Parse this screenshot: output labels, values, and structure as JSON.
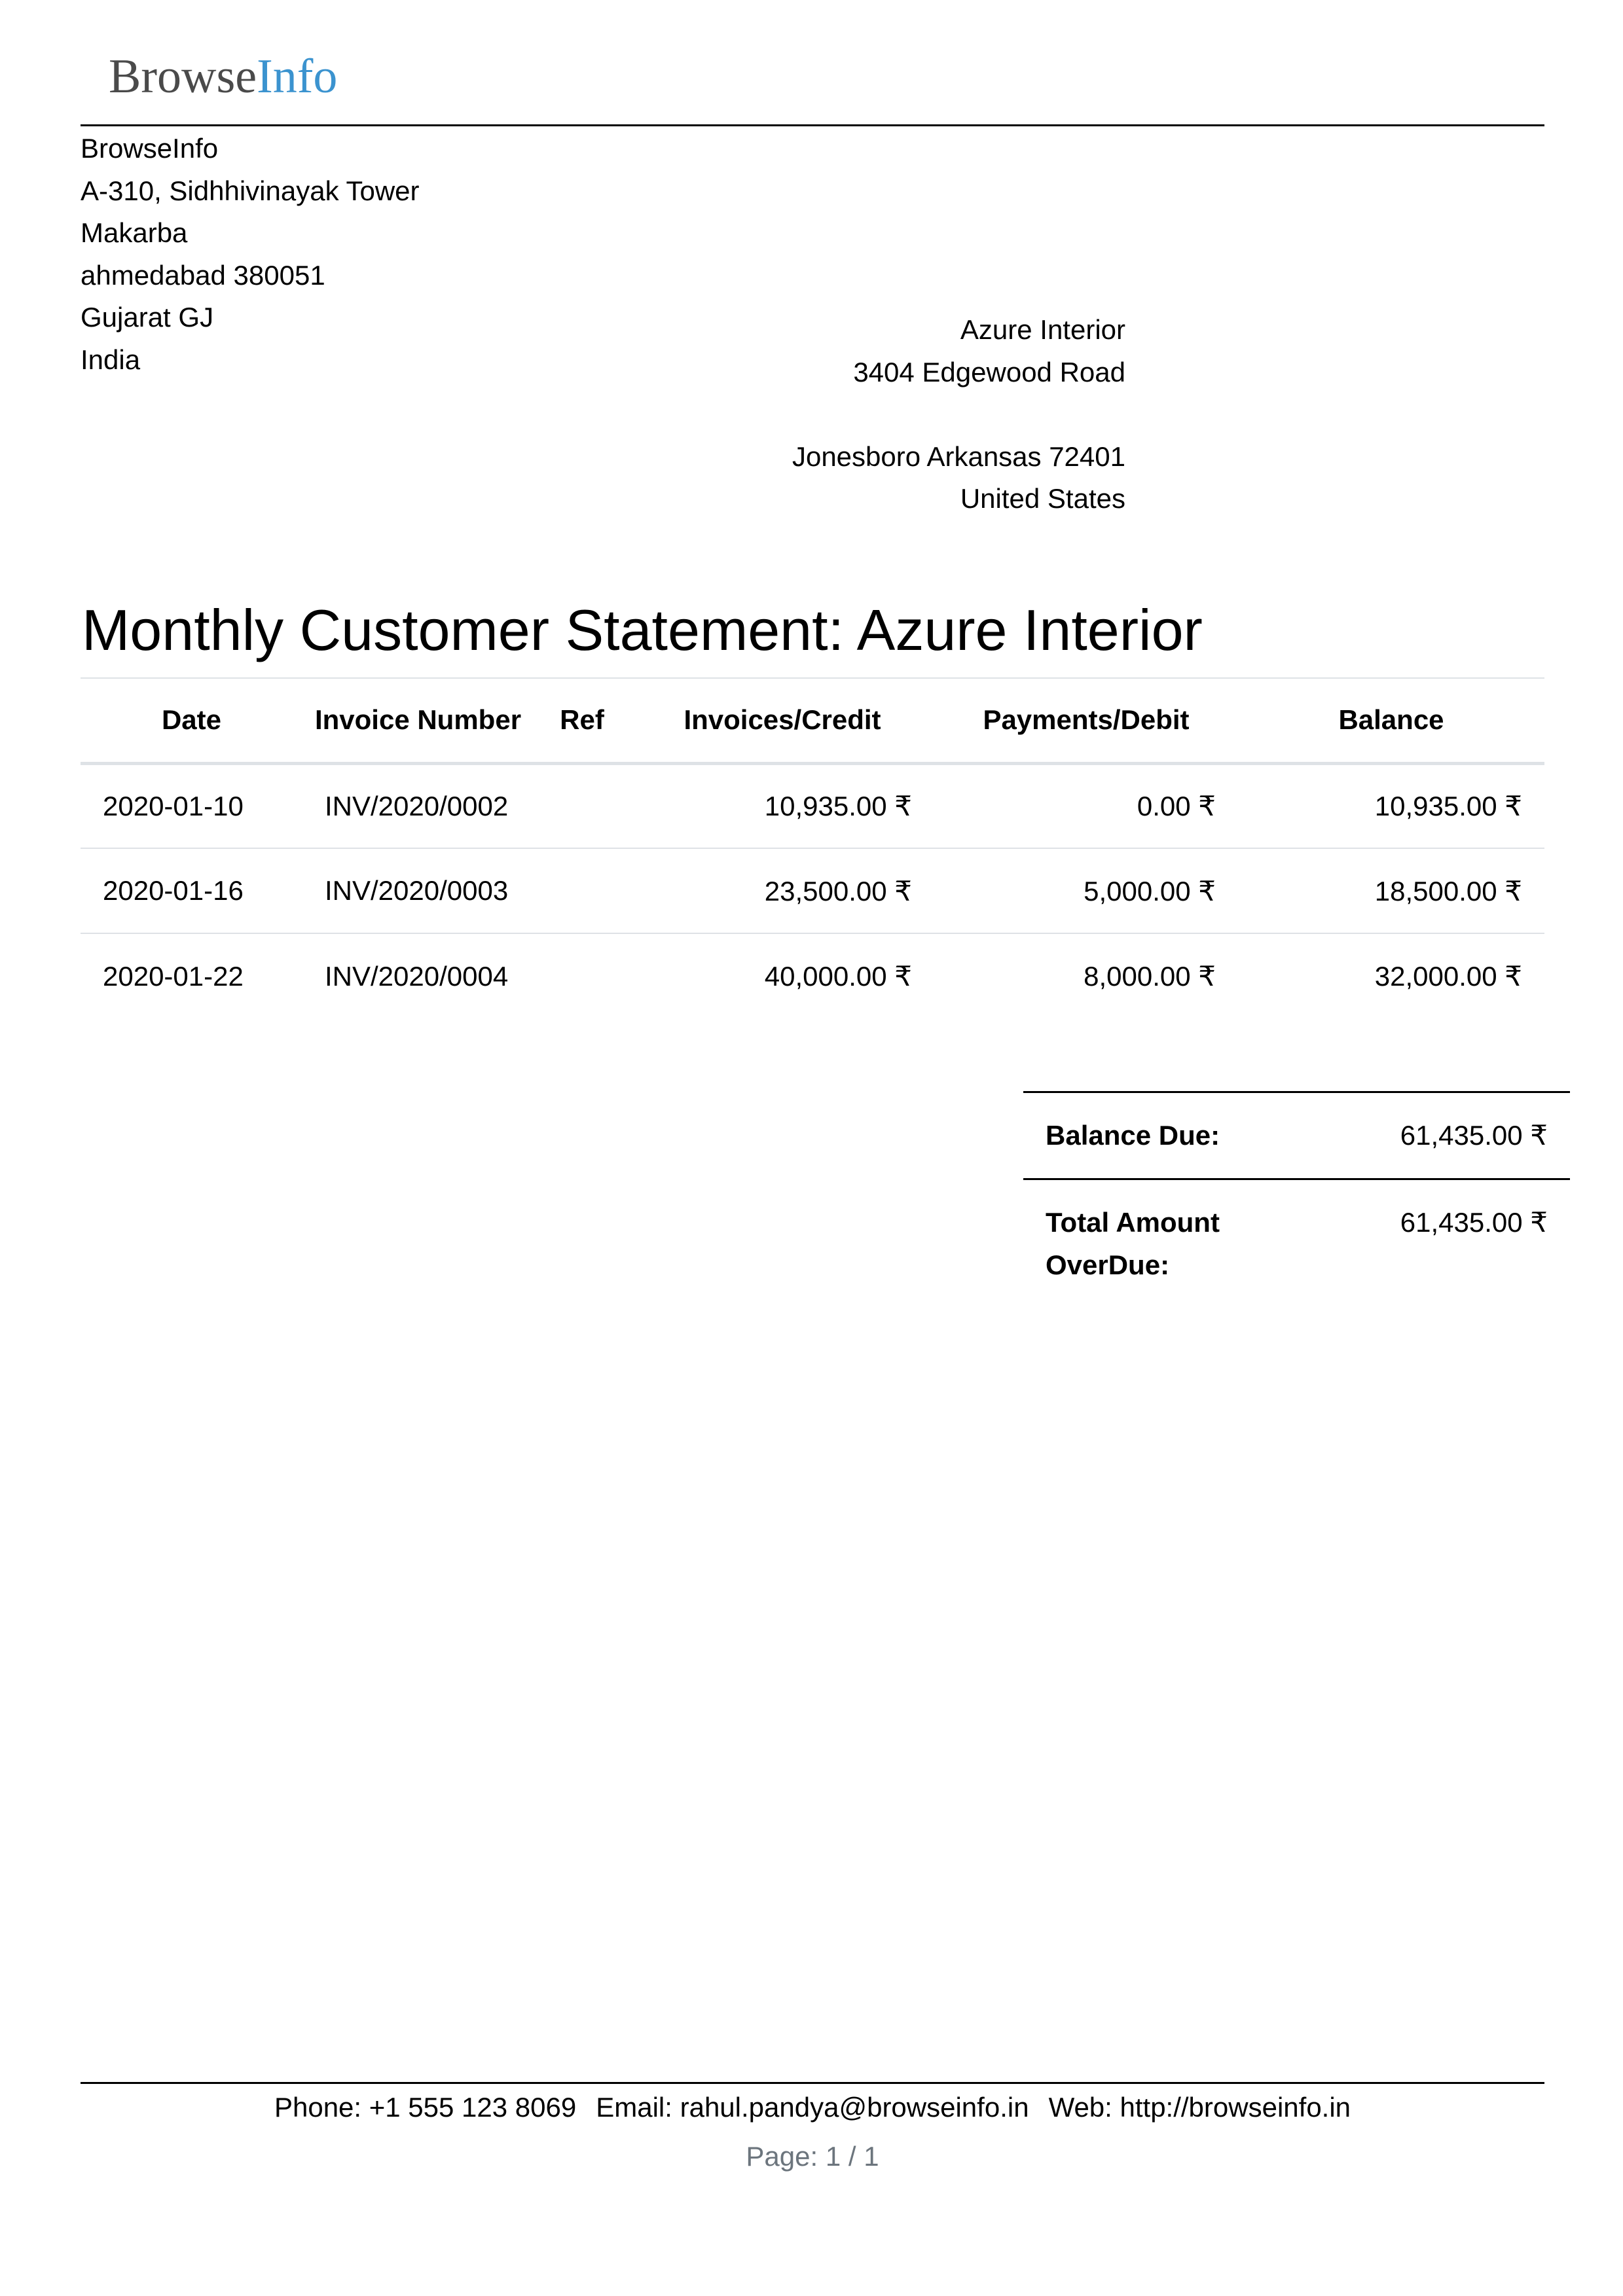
{
  "header": {
    "logo_part1": "Browse",
    "logo_part2": "Info",
    "logo_color_part1": "#4a4a4a",
    "logo_color_part2": "#3b93cf"
  },
  "company": {
    "lines": [
      "BrowseInfo",
      "A-310, Sidhhivinayak Tower",
      "Makarba",
      "ahmedabad 380051",
      "Gujarat GJ",
      "India"
    ]
  },
  "partner": {
    "lines": [
      "Azure Interior",
      "3404 Edgewood Road",
      "",
      "Jonesboro Arkansas 72401",
      "United States"
    ]
  },
  "title": "Monthly Customer Statement: Azure Interior",
  "table": {
    "columns": [
      "Date",
      "Invoice Number",
      "Ref",
      "Invoices/Credit",
      "Payments/Debit",
      "Balance"
    ],
    "rows": [
      {
        "date": "2020-01-10",
        "invoice": "INV/2020/0002",
        "ref": "",
        "credit": "10,935.00 ₹",
        "debit": "0.00 ₹",
        "balance": "10,935.00 ₹"
      },
      {
        "date": "2020-01-16",
        "invoice": "INV/2020/0003",
        "ref": "",
        "credit": "23,500.00 ₹",
        "debit": "5,000.00 ₹",
        "balance": "18,500.00 ₹"
      },
      {
        "date": "2020-01-22",
        "invoice": "INV/2020/0004",
        "ref": "",
        "credit": "40,000.00 ₹",
        "debit": "8,000.00 ₹",
        "balance": "32,000.00 ₹"
      }
    ]
  },
  "totals": {
    "balance_due_label": "Balance Due:",
    "balance_due_value": "61,435.00 ₹",
    "overdue_label_line1": "Total Amount",
    "overdue_label_line2": "OverDue:",
    "overdue_value": "61,435.00 ₹"
  },
  "footer": {
    "phone": "Phone: +1 555 123 8069",
    "email": "Email: rahul.pandya@browseinfo.in",
    "web": "Web: http://browseinfo.in",
    "page": "Page: 1 / 1"
  }
}
